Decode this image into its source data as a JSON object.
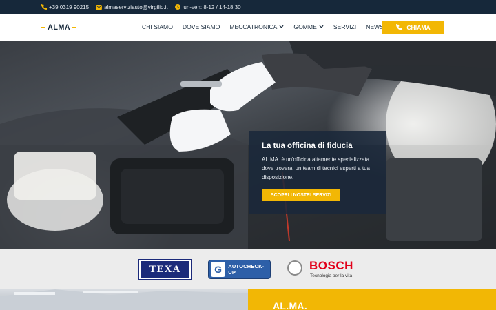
{
  "topbar": {
    "phone": "+39 0319 90215",
    "email": "almaserviziauto@virgilio.it",
    "hours": "lun-ven: 8-12 / 14-18:30"
  },
  "header": {
    "logo": "ALMA",
    "nav": [
      {
        "label": "CHI SIAMO",
        "has_dropdown": false
      },
      {
        "label": "DOVE SIAMO",
        "has_dropdown": false
      },
      {
        "label": "MECCATRONICA",
        "has_dropdown": true
      },
      {
        "label": "GOMME",
        "has_dropdown": true
      },
      {
        "label": "SERVIZI",
        "has_dropdown": false
      },
      {
        "label": "NEWS",
        "has_dropdown": false
      }
    ],
    "call_button": "CHIAMA"
  },
  "hero": {
    "title": "La tua officina di fiducia",
    "text": "AL.MA. è un'officina altamente specializzata dove troverai un team di tecnici esperti a tua disposizione.",
    "button": "SCOPRI I NOSTRI SERVIZI"
  },
  "brands": {
    "texa": "TEXA",
    "autocheck": "AUTOCHECK-UP",
    "bosch_name": "BOSCH",
    "bosch_tagline": "Tecnologia per la vita"
  },
  "bottom": {
    "title": "AL.MA."
  },
  "colors": {
    "accent": "#f2b705",
    "dark": "#16283a",
    "bosch_red": "#e2001a",
    "texa_blue": "#1b2a7a"
  }
}
